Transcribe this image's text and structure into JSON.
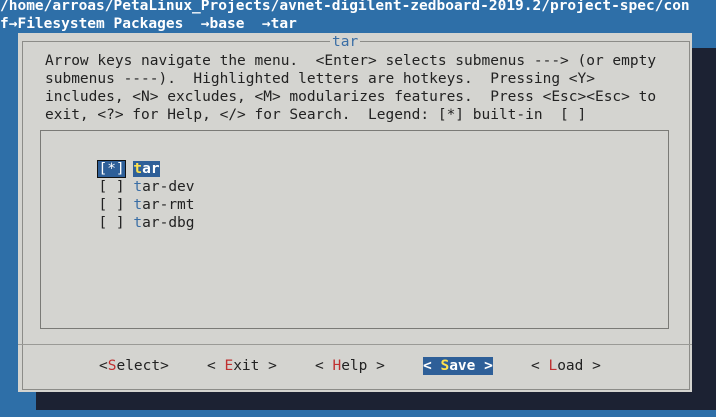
{
  "header": {
    "path": "/home/arroas/PetaLinux_Projects/avnet-digilent-zedboard-2019.2/project-spec/con",
    "breadcrumb": "f→Filesystem Packages  →base  →tar"
  },
  "dialog": {
    "title": "tar",
    "help_lines": [
      "Arrow keys navigate the menu.  <Enter> selects submenus ---> (or empty",
      "submenus ----).  Highlighted letters are hotkeys.  Pressing <Y>",
      "includes, <N> excludes, <M> modularizes features.  Press <Esc><Esc> to",
      "exit, <?> for Help, </> for Search.  Legend: [*] built-in  [ ]"
    ]
  },
  "items": [
    {
      "check": "[*]",
      "hotkey": "t",
      "rest": "ar",
      "selected": true
    },
    {
      "check": "[ ]",
      "hotkey": "t",
      "rest": "ar-dev",
      "selected": false
    },
    {
      "check": "[ ]",
      "hotkey": "t",
      "rest": "ar-rmt",
      "selected": false
    },
    {
      "check": "[ ]",
      "hotkey": "t",
      "rest": "ar-dbg",
      "selected": false
    }
  ],
  "buttons": {
    "select": {
      "pre": "<",
      "hotkey": "S",
      "post": "elect>"
    },
    "exit": {
      "pre": "< ",
      "hotkey": "E",
      "post": "xit >"
    },
    "help": {
      "pre": "< ",
      "hotkey": "H",
      "post": "elp >"
    },
    "save": {
      "pre": "< ",
      "hotkey": "S",
      "post": "ave >"
    },
    "load": {
      "pre": "< ",
      "hotkey": "L",
      "post": "oad >"
    }
  },
  "colors": {
    "background": "#2e6fa8",
    "dialog": "#d4d4d0",
    "selection": "#2e5f98",
    "hotkey_button": "#c03030",
    "hotkey_item": "#3a6ea5",
    "hotkey_selected": "#ffe24d"
  }
}
